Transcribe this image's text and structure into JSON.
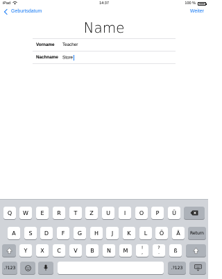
{
  "status_bar": {
    "device": "iPad",
    "wifi_icon": "wifi-icon",
    "time": "14:37",
    "battery_percent_text": "100 %",
    "battery_level": 1.0
  },
  "nav": {
    "back_label": "Geburtsdatum",
    "next_label": "Weiter"
  },
  "page": {
    "title": "Name"
  },
  "form": {
    "fields": [
      {
        "label": "Vorname",
        "value": "Teacher"
      },
      {
        "label": "Nachname",
        "value": "Store"
      }
    ]
  },
  "keyboard": {
    "row1": [
      "Q",
      "W",
      "E",
      "R",
      "T",
      "Z",
      "U",
      "I",
      "O",
      "P",
      "Ü"
    ],
    "row2": [
      "A",
      "S",
      "D",
      "F",
      "G",
      "H",
      "J",
      "K",
      "L",
      "Ö",
      "Ä"
    ],
    "row3": [
      "Y",
      "X",
      "C",
      "V",
      "B",
      "N",
      "M"
    ],
    "punct1": {
      "top": "!",
      "bottom": ","
    },
    "punct2": {
      "top": "?",
      "bottom": "."
    },
    "sz": "ß",
    "return_label": "Return",
    "numbers_label": ".?123",
    "icons": {
      "backspace": "backspace-icon",
      "shift": "shift-icon",
      "emoji": "emoji-icon",
      "dictation": "microphone-icon",
      "hide_keyboard": "keyboard-dismiss-icon"
    }
  }
}
